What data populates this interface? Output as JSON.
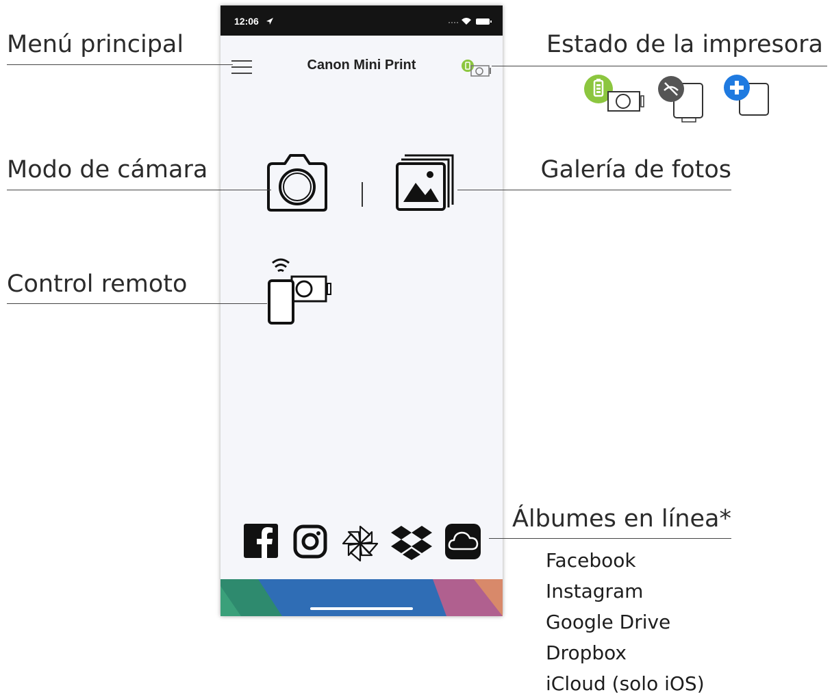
{
  "status_bar": {
    "time": "12:06"
  },
  "app": {
    "title": "Canon Mini Print"
  },
  "callouts": {
    "main_menu": "Menú principal",
    "printer_status": "Estado de la impresora",
    "camera_mode": "Modo de cámara",
    "photo_gallery": "Galería de fotos",
    "remote_control": "Control remoto",
    "online_albums": "Álbumes en línea*"
  },
  "online_album_services": [
    "Facebook",
    "Instagram",
    "Google Drive",
    "Dropbox",
    "iCloud (solo iOS)"
  ],
  "colors": {
    "battery_green": "#8cc63f",
    "disconnected_gray": "#555555",
    "add_blue": "#1f7ae0",
    "status_bar": "#141414"
  }
}
